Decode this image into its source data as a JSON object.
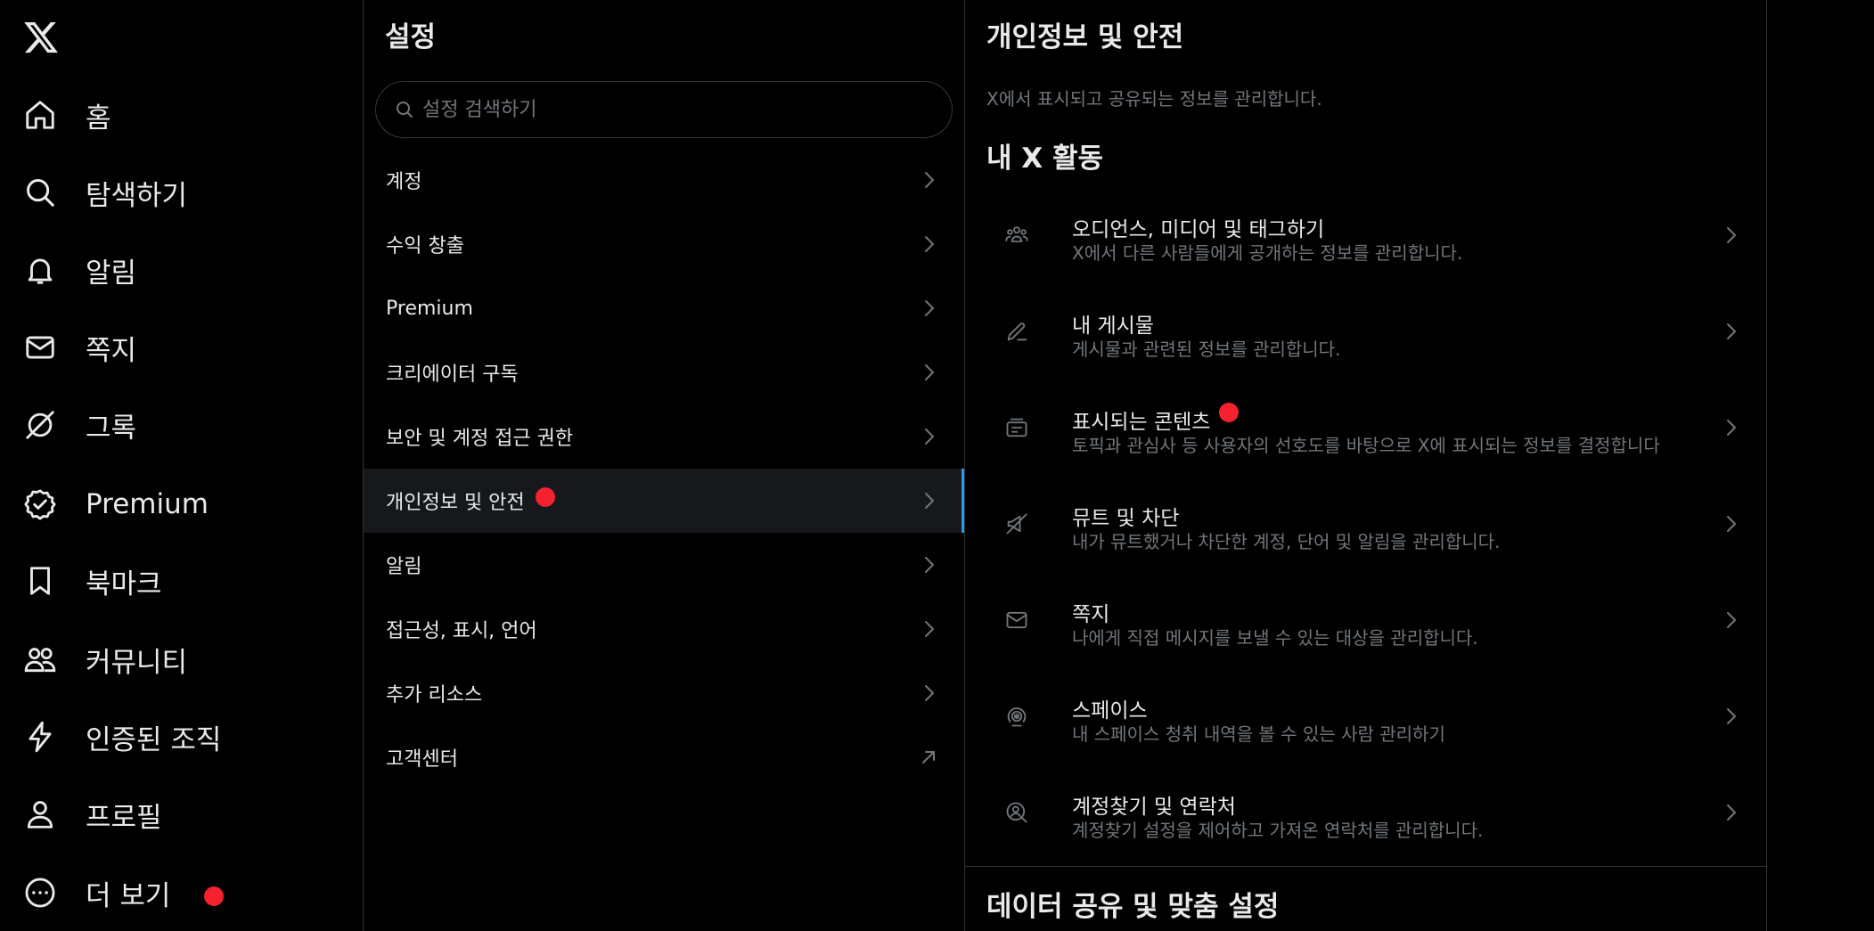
{
  "nav": {
    "items": [
      {
        "label": "홈"
      },
      {
        "label": "탐색하기"
      },
      {
        "label": "알림"
      },
      {
        "label": "쪽지"
      },
      {
        "label": "그록"
      },
      {
        "label": "Premium"
      },
      {
        "label": "북마크"
      },
      {
        "label": "커뮤니티"
      },
      {
        "label": "인증된 조직"
      },
      {
        "label": "프로필"
      },
      {
        "label": "더 보기"
      }
    ]
  },
  "settings": {
    "title": "설정",
    "search_placeholder": "설정 검색하기",
    "items": [
      {
        "label": "계정"
      },
      {
        "label": "수익 창출"
      },
      {
        "label": "Premium"
      },
      {
        "label": "크리에이터 구독"
      },
      {
        "label": "보안 및 계정 접근 권한"
      },
      {
        "label": "개인정보 및 안전"
      },
      {
        "label": "알림"
      },
      {
        "label": "접근성, 표시, 언어"
      },
      {
        "label": "추가 리소스"
      },
      {
        "label": "고객센터"
      }
    ]
  },
  "detail": {
    "title": "개인정보 및 안전",
    "description": "X에서 표시되고 공유되는 정보를 관리합니다.",
    "section1": "내 X 활동",
    "options": [
      {
        "title": "오디언스, 미디어 및 태그하기",
        "subtitle": "X에서 다른 사람들에게 공개하는 정보를 관리합니다."
      },
      {
        "title": "내 게시물",
        "subtitle": "게시물과 관련된 정보를 관리합니다."
      },
      {
        "title": "표시되는 콘텐츠",
        "subtitle": "토픽과 관심사 등 사용자의 선호도를 바탕으로 X에 표시되는 정보를 결정합니다"
      },
      {
        "title": "뮤트 및 차단",
        "subtitle": "내가 뮤트했거나 차단한 계정, 단어 및 알림을 관리합니다."
      },
      {
        "title": "쪽지",
        "subtitle": "나에게 직접 메시지를 보낼 수 있는 대상을 관리합니다."
      },
      {
        "title": "스페이스",
        "subtitle": "내 스페이스 청취 내역을 볼 수 있는 사람 관리하기"
      },
      {
        "title": "계정찾기 및 연락처",
        "subtitle": "계정찾기 설정을 제어하고 가져온 연락처를 관리합니다."
      }
    ],
    "section2": "데이터 공유 및 맞춤 설정"
  },
  "colors": {
    "background": "#000000",
    "text": "#e7e9ea",
    "muted": "#71767b",
    "accent": "#1d9bf0",
    "notification_dot": "#f4212e"
  }
}
